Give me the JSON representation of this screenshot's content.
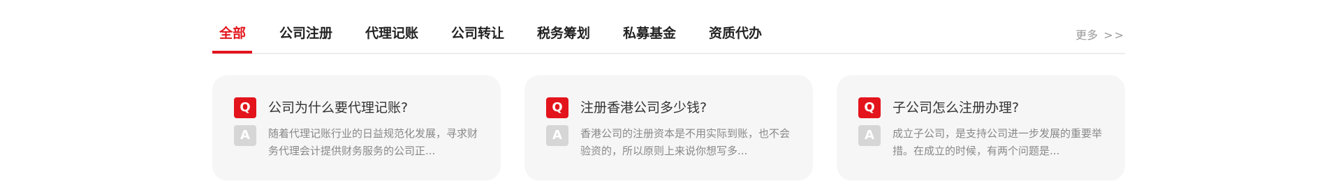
{
  "tabs": [
    "全部",
    "公司注册",
    "代理记账",
    "公司转让",
    "税务筹划",
    "私募基金",
    "资质代办"
  ],
  "more": {
    "label": "更多",
    "arrows": ">>"
  },
  "faqs": [
    {
      "question": "公司为什么要代理记账?",
      "answer": "随着代理记账行业的日益规范化发展，寻求财务代理会计提供财务服务的公司正..."
    },
    {
      "question": "注册香港公司多少钱?",
      "answer": "香港公司的注册资本是不用实际到账，也不会验资的，所以原则上来说你想写多..."
    },
    {
      "question": "子公司怎么注册办理?",
      "answer": "成立子公司，是支持公司进一步发展的重要举措。在成立的时候，有两个问题是..."
    }
  ],
  "badges": {
    "q": "Q",
    "a": "A"
  },
  "colors": {
    "accent": "#e3141c",
    "card_bg": "#f6f6f7",
    "a_badge": "#d6d6d6"
  }
}
